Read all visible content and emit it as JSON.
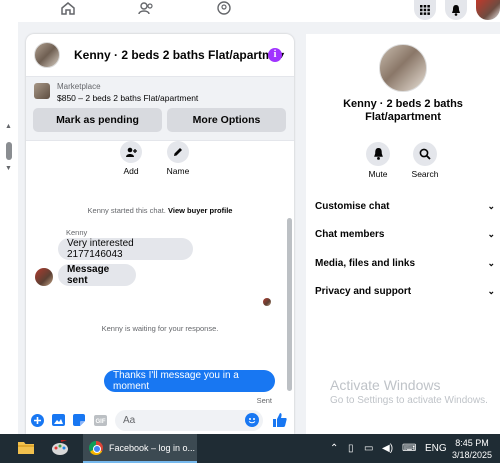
{
  "topbar": {
    "nav_icons": [
      "home-icon",
      "friends-icon",
      "groups-icon"
    ],
    "right_icons": [
      "menu-grid-icon",
      "bell-icon",
      "profile-avatar"
    ]
  },
  "chat": {
    "title": "Kenny · 2 beds 2 baths Flat/apartme...",
    "marketplace": {
      "label": "Marketplace",
      "listing": "$850 – 2 beds 2 baths Flat/apartment",
      "mark_pending": "Mark as pending",
      "more_options": "More Options"
    },
    "actions": [
      {
        "label": "Add",
        "icon": "add-person-icon"
      },
      {
        "label": "Name",
        "icon": "pencil-icon"
      }
    ],
    "started_text": "Kenny started this chat.",
    "view_profile": "View buyer profile",
    "sender_name": "Kenny",
    "messages_in": [
      "Very interested 2177146043",
      "Message sent"
    ],
    "waiting_text": "Kenny is waiting for your response.",
    "message_out": "Thanks I'll message you in a moment",
    "sent_status": "Sent",
    "composer_placeholder": "Aa",
    "colors": {
      "accent": "#1877f2",
      "info": "#a033ff"
    }
  },
  "right_panel": {
    "name": "Kenny · 2 beds 2 baths Flat/apartment",
    "actions": [
      {
        "label": "Mute",
        "icon": "bell-icon"
      },
      {
        "label": "Search",
        "icon": "search-icon"
      }
    ],
    "sections": [
      "Customise chat",
      "Chat members",
      "Media, files and links",
      "Privacy and support"
    ]
  },
  "watermark": {
    "title": "Activate Windows",
    "subtitle": "Go to Settings to activate Windows."
  },
  "taskbar": {
    "app_label": "Facebook – log in o...",
    "language": "ENG",
    "time": "8:45 PM",
    "date": "3/18/2025"
  }
}
